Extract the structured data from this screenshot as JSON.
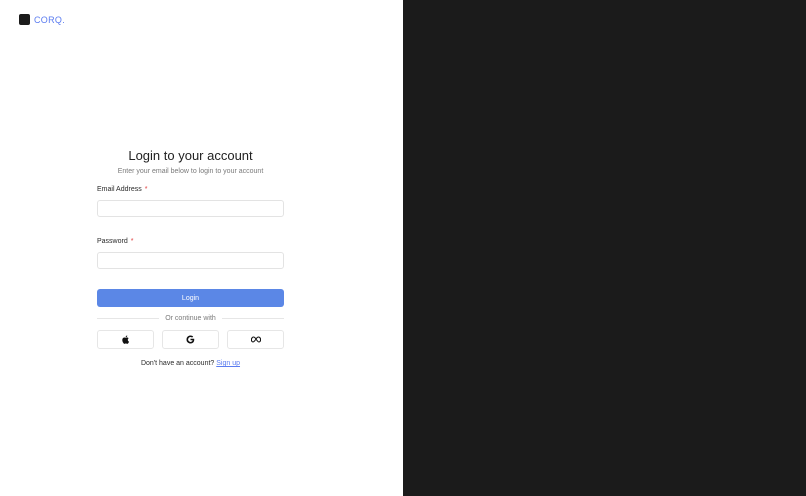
{
  "brand": {
    "name": "CORQ."
  },
  "form": {
    "title": "Login to your account",
    "subtitle": "Enter your email below to login to your account",
    "email_label": "Email Address",
    "password_label": "Password",
    "required_mark": "*",
    "email_value": "",
    "password_value": "",
    "login_label": "Login",
    "divider_text": "Or continue with",
    "signup_prompt": "Don't have an account?",
    "signup_link": "Sign up"
  },
  "social": [
    "apple-icon",
    "google-icon",
    "meta-icon"
  ],
  "colors": {
    "accent": "#5b87e6",
    "link": "#5b7cf0",
    "panel": "#1b1b1b"
  }
}
